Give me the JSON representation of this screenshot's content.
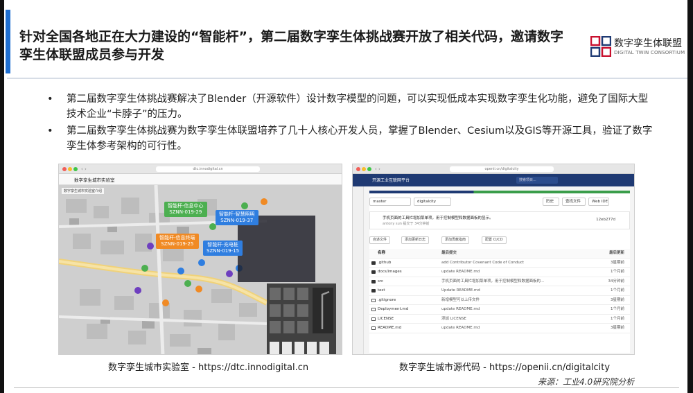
{
  "title": "针对全国各地正在大力建设的“智能杆”，第二届数字孪生体挑战赛开放了相关代码，邀请数字孪生体联盟成员参与开发",
  "logo": {
    "name_cn": "数字孪生体联盟",
    "name_en": "DIGITAL TWIN CONSORTIUM",
    "accent_colors": [
      "#c8102e",
      "#1f3a73"
    ]
  },
  "bullets": [
    "第二届数字孪生体挑战赛解决了Blender（开源软件）设计数字模型的问题，可以实现低成本实现数字孪生化功能，避免了国际大型技术企业“卡脖子”的压力。",
    "第二届数字孪生体挑战赛为数字孪生体联盟培养了几十人核心开发人员，掌握了Blender、Cesium以及GIS等开源工具，验证了数字孪生体参考架构的可行性。"
  ],
  "screenshots": {
    "left": {
      "url": "dtc.innodigital.cn",
      "brand": "数字孪生城市实验室",
      "subtitle": "数字孪生城市实验室介绍",
      "callouts": [
        {
          "line1": "智能杆-信息中心",
          "line2": "SZNN-019-29",
          "color": "green"
        },
        {
          "line1": "智能杆-智慧照明",
          "line2": "SZNN-019-37",
          "color": "blue"
        },
        {
          "line1": "智能杆-信息终端",
          "line2": "SZNN-019-25",
          "color": "orange"
        },
        {
          "line1": "智能杆-充电桩",
          "line2": "SZNN-019-15",
          "color": "blue"
        }
      ]
    },
    "right": {
      "url": "openii.cn/digitalcity",
      "brand": "开源工业互联网平台",
      "search_placeholder": "搜索项目...",
      "branch": "master",
      "repo": "digitalcity",
      "buttons": [
        "历史",
        "查找文件",
        "Web IDE"
      ],
      "commit": {
        "message": "手机页面的工具栏增加菜单项，用于控制模型和数据面板的显示。",
        "author": "antony sun 提交于 34分钟前",
        "sha": "12eb277d"
      },
      "actions": [
        "自述文件",
        "添加更新日志",
        "添加贡献指南",
        "配置 CI/CD"
      ],
      "table_headers": [
        "名称",
        "最后提交",
        "最后更新"
      ],
      "files": [
        {
          "name": ".github",
          "type": "dir",
          "message": "add Contributor Covenant Code of Conduct",
          "time": "3星期前"
        },
        {
          "name": "docs/images",
          "type": "dir",
          "message": "update README.md",
          "time": "1个月前"
        },
        {
          "name": "src",
          "type": "dir",
          "message": "手机页面的工具栏增加菜单项，用于控制模型和数据面板的...",
          "time": "34分钟前"
        },
        {
          "name": "test",
          "type": "dir",
          "message": "Update README.md",
          "time": "1个月前"
        },
        {
          "name": ".gitignore",
          "type": "file",
          "message": "新增模型可以上传文件",
          "time": "3星期前"
        },
        {
          "name": "Deployment.md",
          "type": "file",
          "message": "update README.md",
          "time": "1个月前"
        },
        {
          "name": "LICENSE",
          "type": "file",
          "message": "添加 LICENSE",
          "time": "1个月前"
        },
        {
          "name": "README.md",
          "type": "file",
          "message": "update README.md",
          "time": "3星期前"
        }
      ]
    }
  },
  "captions": {
    "left": "数字孪生城市实验室 - https://dtc.innodigital.cn",
    "right": "数字孪生城市源代码 - https://openii.cn/digitalcity"
  },
  "source": "来源：工业4.0研究院分析",
  "colors": {
    "title_accent": "#1f6fd1",
    "callout_green": "#4caf50",
    "callout_blue": "#2f7ee0",
    "callout_orange": "#f08a24"
  }
}
